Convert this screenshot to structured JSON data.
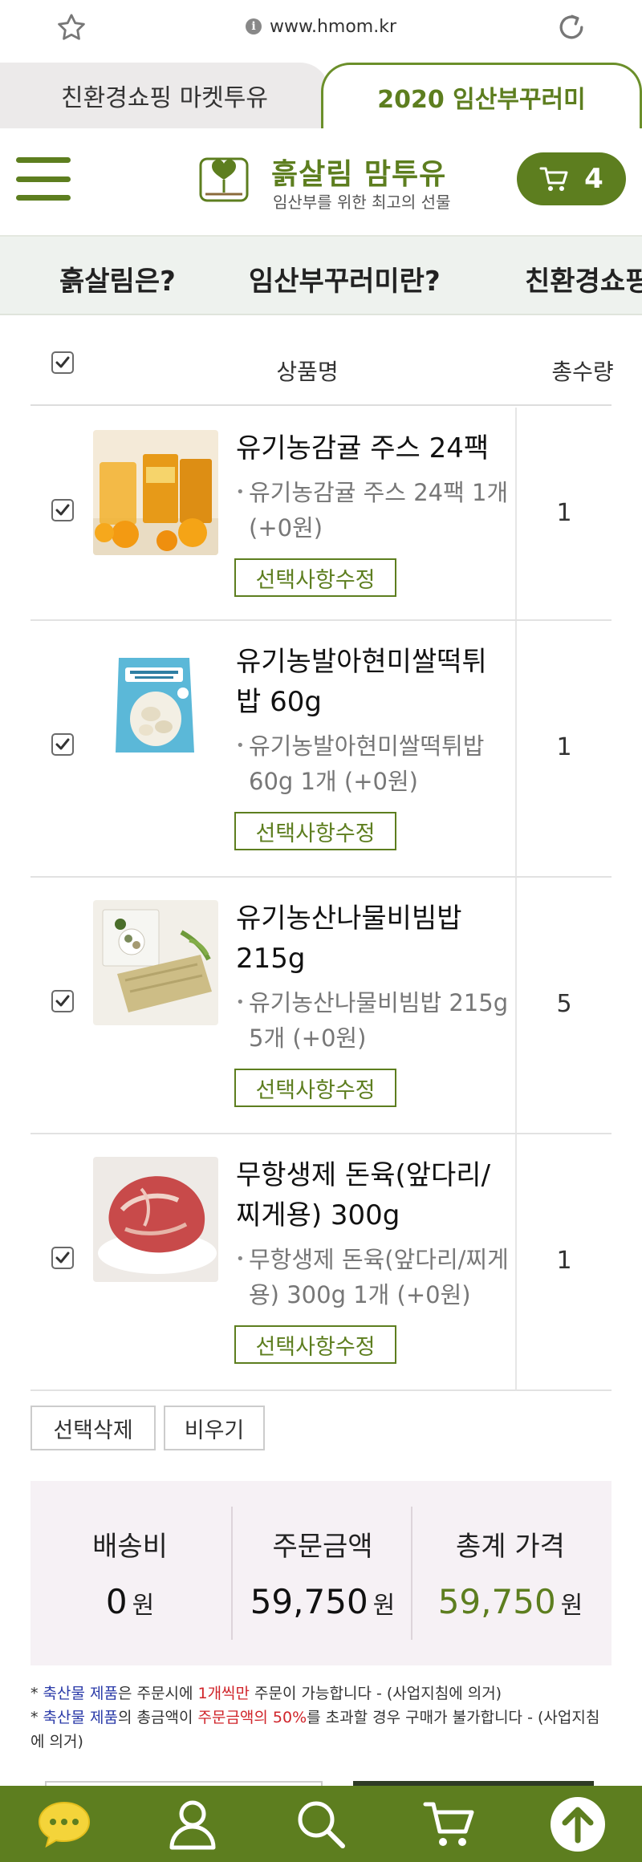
{
  "browser": {
    "url": "www.hmom.kr",
    "info_glyph": "i"
  },
  "site_tabs": [
    {
      "label": "친환경쇼핑 마켓투유",
      "active": false
    },
    {
      "label": "2020 임산부꾸러미",
      "active": true
    }
  ],
  "header": {
    "logo_title": "흙살림 맘투유",
    "logo_subtitle": "임산부를 위한 최고의 선물",
    "cart_count": "4"
  },
  "menu": [
    {
      "label": "흙살림은?"
    },
    {
      "label": "임산부꾸러미란?"
    },
    {
      "label": "친환경쇼핑"
    }
  ],
  "cart": {
    "columns": {
      "name": "상품명",
      "qty": "총수량"
    },
    "edit_label": "선택사항수정",
    "items": [
      {
        "name": "유기농감귤 주스 24팩",
        "option": "유기농감귤 주스 24팩 1개 (+0원)",
        "qty": "1",
        "checked": true,
        "thumb_icon": "juice-product-image"
      },
      {
        "name": "유기농발아현미쌀떡튀밥 60g",
        "option": "유기농발아현미쌀떡튀밥 60g 1개 (+0원)",
        "qty": "1",
        "checked": true,
        "thumb_icon": "rice-snack-product-image"
      },
      {
        "name": "유기농산나물비빔밥 215g",
        "option": "유기농산나물비빔밥 215g 5개 (+0원)",
        "qty": "5",
        "checked": true,
        "thumb_icon": "bibimbap-product-image"
      },
      {
        "name": "무항생제 돈육(앞다리/찌게용) 300g",
        "option": "무항생제 돈육(앞다리/찌게용) 300g 1개 (+0원)",
        "qty": "1",
        "checked": true,
        "thumb_icon": "pork-product-image"
      }
    ],
    "delete_selected": "선택삭제",
    "empty_cart": "비우기"
  },
  "summary": {
    "shipping_label": "배송비",
    "shipping_value": "0",
    "order_label": "주문금액",
    "order_value": "59,750",
    "total_label": "총계 가격",
    "total_value": "59,750",
    "unit": "원"
  },
  "notices": {
    "n1": {
      "star": "* ",
      "blue": "축산물 제품",
      "a": "은 주문시에 ",
      "red": "1개씩만",
      "b": " 주문이 가능합니다 - (사업지침에 의거)"
    },
    "n2": {
      "star": "* ",
      "blue": "축산물 제품",
      "a": "의 총금액이 ",
      "red": "주문금액의 50%",
      "b": "를 초과할 경우 구매가 불가합니다 - (사업지침에 의거)"
    }
  },
  "bottom_nav": [
    "chat-icon",
    "user-icon",
    "search-icon",
    "cart-icon",
    "scroll-top-icon"
  ],
  "colors": {
    "brand_green": "#5d7e1f",
    "notice_blue": "#2a3aa8",
    "notice_red": "#d0242a",
    "summary_bg": "#f6f1f5"
  }
}
